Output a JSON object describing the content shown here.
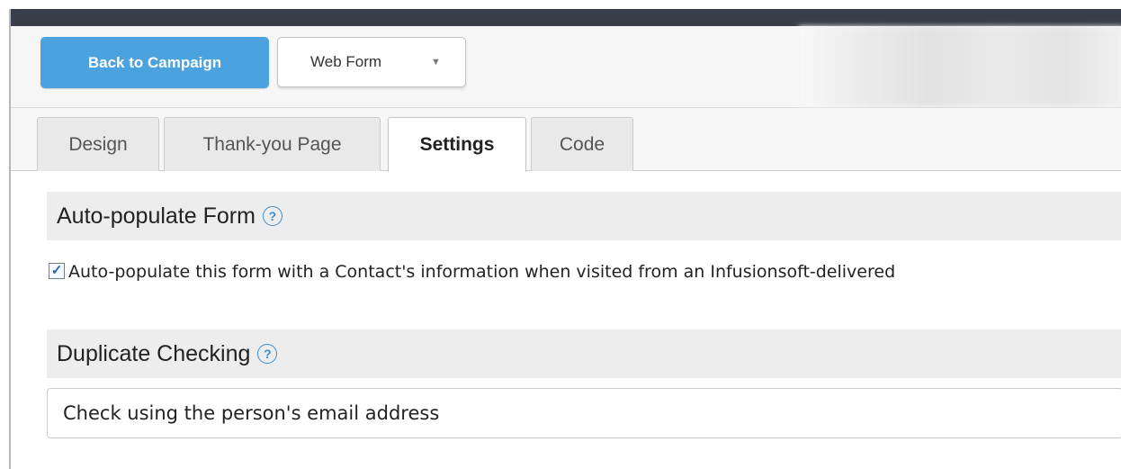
{
  "toolbar": {
    "back_label": "Back to Campaign",
    "web_form_label": "Web Form",
    "caret": "▼"
  },
  "tabs": [
    {
      "label": "Design",
      "active": false
    },
    {
      "label": "Thank-you Page",
      "active": false
    },
    {
      "label": "Settings",
      "active": true
    },
    {
      "label": "Code",
      "active": false
    }
  ],
  "autopopulate": {
    "title": "Auto-populate Form",
    "help_glyph": "?",
    "checked": true,
    "checkbox_label": "Auto-populate this form with a Contact's information when visited from an Infusionsoft-delivered"
  },
  "duplicate": {
    "title": "Duplicate Checking",
    "help_glyph": "?",
    "selected_value": "Check using the person's email address"
  },
  "colors": {
    "accent": "#4aa3df",
    "topbar": "#3a3d4a",
    "help": "#3a8ed0"
  }
}
